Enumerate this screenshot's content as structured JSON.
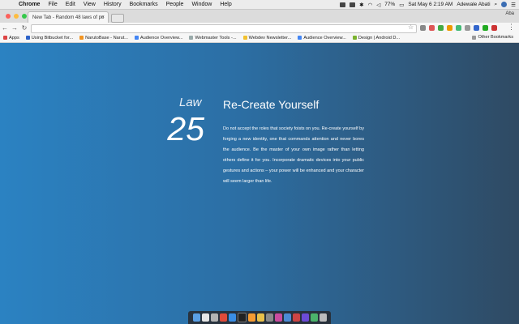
{
  "menubar": {
    "app_name": "Chrome",
    "menus": [
      "File",
      "Edit",
      "View",
      "History",
      "Bookmarks",
      "People",
      "Window",
      "Help"
    ],
    "status": {
      "battery": "77%",
      "datetime": "Sat May 6  2:19 AM",
      "user": "Adewale Abati"
    }
  },
  "tabstrip": {
    "tab_title": "New Tab - Random 48 laws of po",
    "profile_name": "Aba"
  },
  "toolbar": {
    "url_value": ""
  },
  "bookmarks": {
    "items": [
      "Apps",
      "Using Bitbucket for...",
      "NarutoBase - Narut...",
      "Audience Overview...",
      "Webmaster Tools -...",
      "Webdev Newsletter...",
      "Audience Overview...",
      "Design | Android D..."
    ],
    "other": "Other Bookmarks"
  },
  "law": {
    "label": "Law",
    "number": "25",
    "title": "Re-Create Yourself",
    "body": "Do not accept the roles that society foists on you. Re-create yourself by forging a new identity, one that commands attention and never bores the audience. Be the master of your own image rather than letting others define it for you. Incorporate dramatic devices into your public gestures and actions – your power will be enhanced and your character will seem larger than life."
  },
  "colors": {
    "gradient_left": "#2b82c2",
    "gradient_right": "#2f4a63",
    "text": "#ffffff"
  }
}
